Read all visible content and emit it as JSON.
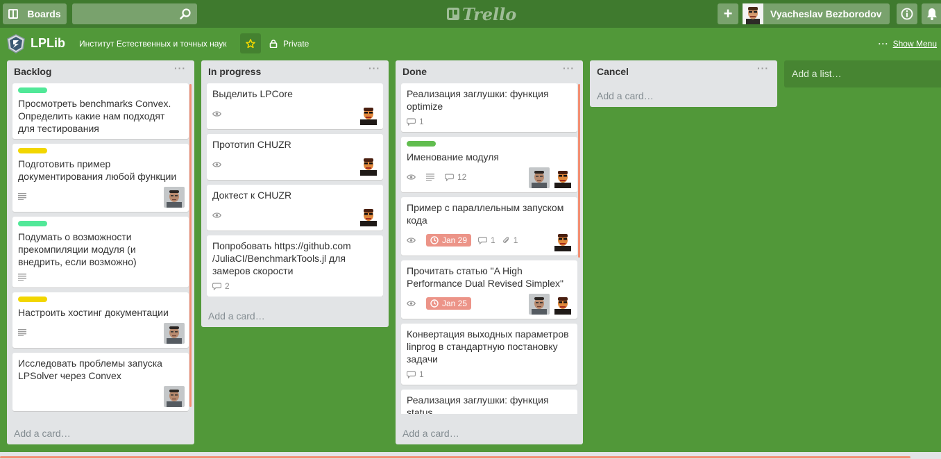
{
  "header": {
    "boards_label": "Boards",
    "search_value": "",
    "logo_text": "Trello",
    "user_name": "Vyacheslav Bezborodov"
  },
  "board": {
    "title": "LPLib",
    "org": "Институт Естественных и точных наук",
    "visibility": "Private",
    "menu_label": "Show Menu",
    "star_color": "#f2d600"
  },
  "colors": {
    "board_bg": "#519839",
    "label_green": "#61bd4f",
    "label_teal": "#51e898",
    "label_yellow": "#f2d600",
    "due_red": "#ec9488",
    "scroll": "#f28f73"
  },
  "lists": [
    {
      "title": "Backlog",
      "add_card": "Add a card…",
      "cards": [
        {
          "label": "#51e898",
          "title": "Просмотреть benchmarks Convex. Определить какие нам подходят для тестирования",
          "desc": false,
          "watch": false,
          "comments": "",
          "due": "",
          "attach": "",
          "members": []
        },
        {
          "label": "#f2d600",
          "title": "Подготовить пример документирования любой функции",
          "desc": true,
          "watch": false,
          "comments": "",
          "due": "",
          "attach": "",
          "members": [
            "face-b"
          ]
        },
        {
          "label": "#51e898",
          "title": "Подумать о возможности прекомпиляции модуля (и внедрить, если возможно)",
          "desc": true,
          "watch": false,
          "comments": "",
          "due": "",
          "attach": "",
          "members": []
        },
        {
          "label": "#f2d600",
          "title": "Настроить хостинг документации",
          "desc": true,
          "watch": false,
          "comments": "",
          "due": "",
          "attach": "",
          "members": [
            "face-b"
          ]
        },
        {
          "label": "",
          "title": "Исследовать проблемы запуска LPSolver через Convex",
          "desc": false,
          "watch": false,
          "comments": "",
          "due": "",
          "attach": "",
          "members": [
            "face-b"
          ]
        }
      ]
    },
    {
      "title": "In progress",
      "add_card": "Add a card…",
      "cards": [
        {
          "label": "",
          "title": "Выделить LPCore",
          "desc": false,
          "watch": true,
          "comments": "",
          "due": "",
          "attach": "",
          "members": [
            "face-a"
          ]
        },
        {
          "label": "",
          "title": "Прототип CHUZR",
          "desc": false,
          "watch": true,
          "comments": "",
          "due": "",
          "attach": "",
          "members": [
            "face-a"
          ]
        },
        {
          "label": "",
          "title": "Доктест к CHUZR",
          "desc": false,
          "watch": true,
          "comments": "",
          "due": "",
          "attach": "",
          "members": [
            "face-a"
          ]
        },
        {
          "label": "",
          "title": "Попробовать https://github.com /JuliaCI/BenchmarkTools.jl для замеров скорости",
          "desc": false,
          "watch": false,
          "comments": "2",
          "due": "",
          "attach": "",
          "members": []
        }
      ]
    },
    {
      "title": "Done",
      "add_card": "Add a card…",
      "cards": [
        {
          "label": "",
          "title": "Реализация заглушки: функция optimize",
          "desc": false,
          "watch": false,
          "comments": "1",
          "due": "",
          "attach": "",
          "members": []
        },
        {
          "label": "#61bd4f",
          "title": "Именование модуля",
          "desc": true,
          "watch": true,
          "comments": "12",
          "due": "",
          "attach": "",
          "members": [
            "face-b",
            "face-a"
          ]
        },
        {
          "label": "",
          "title": "Пример с параллельным запуском кода",
          "desc": false,
          "watch": true,
          "comments": "1",
          "due": "Jan 29",
          "attach": "1",
          "members": [
            "face-a"
          ]
        },
        {
          "label": "",
          "title": "Прочитать статью \"A High Performance Dual Revised Simplex\"",
          "desc": false,
          "watch": true,
          "comments": "",
          "due": "Jan 25",
          "attach": "",
          "members": [
            "face-b",
            "face-a"
          ]
        },
        {
          "label": "",
          "title": "Конвертация выходных параметров linprog в стандартную постановку задачи",
          "desc": false,
          "watch": false,
          "comments": "1",
          "due": "",
          "attach": "",
          "members": []
        },
        {
          "label": "",
          "title": "Реализация заглушки: функция status",
          "desc": false,
          "watch": false,
          "comments": "",
          "due": "",
          "attach": "",
          "members": []
        }
      ]
    },
    {
      "title": "Cancel",
      "add_card": "Add a card…",
      "cards": []
    }
  ],
  "add_list_label": "Add a list…"
}
